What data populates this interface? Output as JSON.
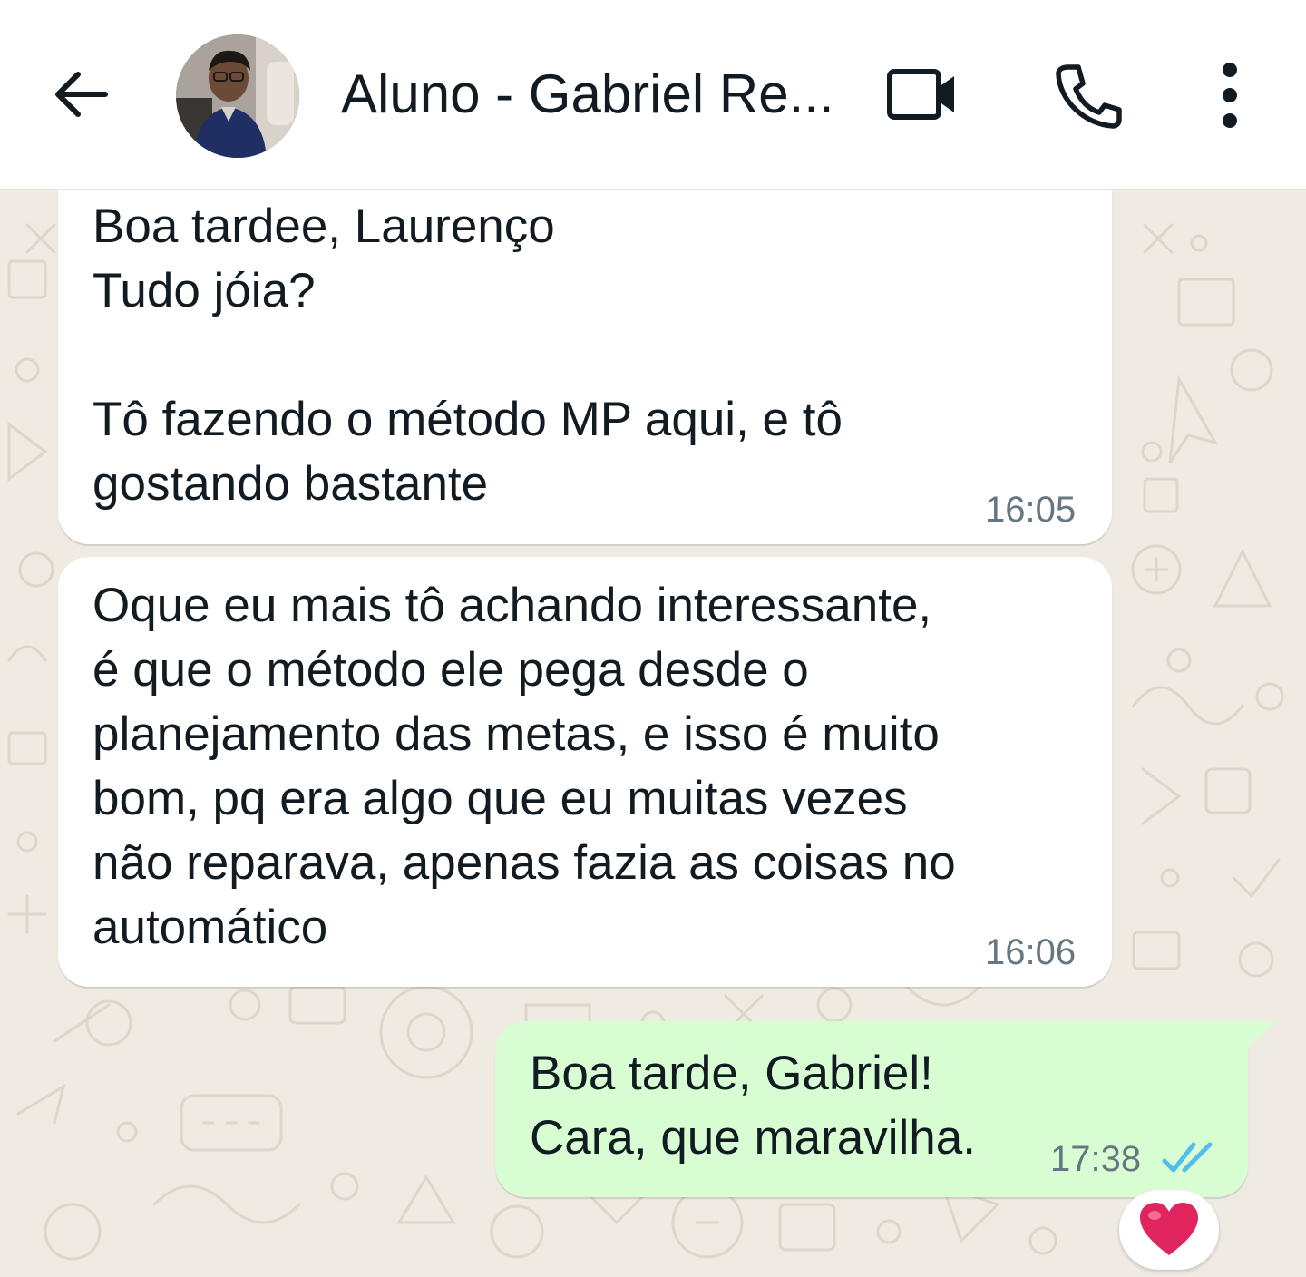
{
  "header": {
    "contact_name": "Aluno - Gabriel Re...",
    "icons": {
      "back": "back-arrow-icon",
      "video": "video-camera-icon",
      "call": "phone-icon",
      "menu": "more-vertical-icon"
    }
  },
  "messages": [
    {
      "direction": "incoming",
      "text": "Boa tardee, Laurenço\nTudo jóia?\n\nTô fazendo o método MP aqui, e tô\ngostando bastante",
      "time": "16:05"
    },
    {
      "direction": "incoming",
      "text": "Oque eu mais tô achando interessante,\né que o método ele pega desde o\nplanejamento das metas, e isso é muito\nbom, pq era algo que eu muitas vezes\nnão reparava, apenas fazia as coisas no\nautomático",
      "time": "16:06"
    },
    {
      "direction": "outgoing",
      "text": "Boa tarde, Gabriel!\nCara, que maravilha.",
      "time": "17:38",
      "status": "read",
      "status_icon": "double-check-icon",
      "reaction": "heart"
    }
  ],
  "colors": {
    "wallpaper": "#efeae2",
    "incoming_bubble": "#ffffff",
    "outgoing_bubble": "#d9fdd3",
    "read_ticks": "#53bdeb",
    "reaction_heart": "#e0245e"
  }
}
